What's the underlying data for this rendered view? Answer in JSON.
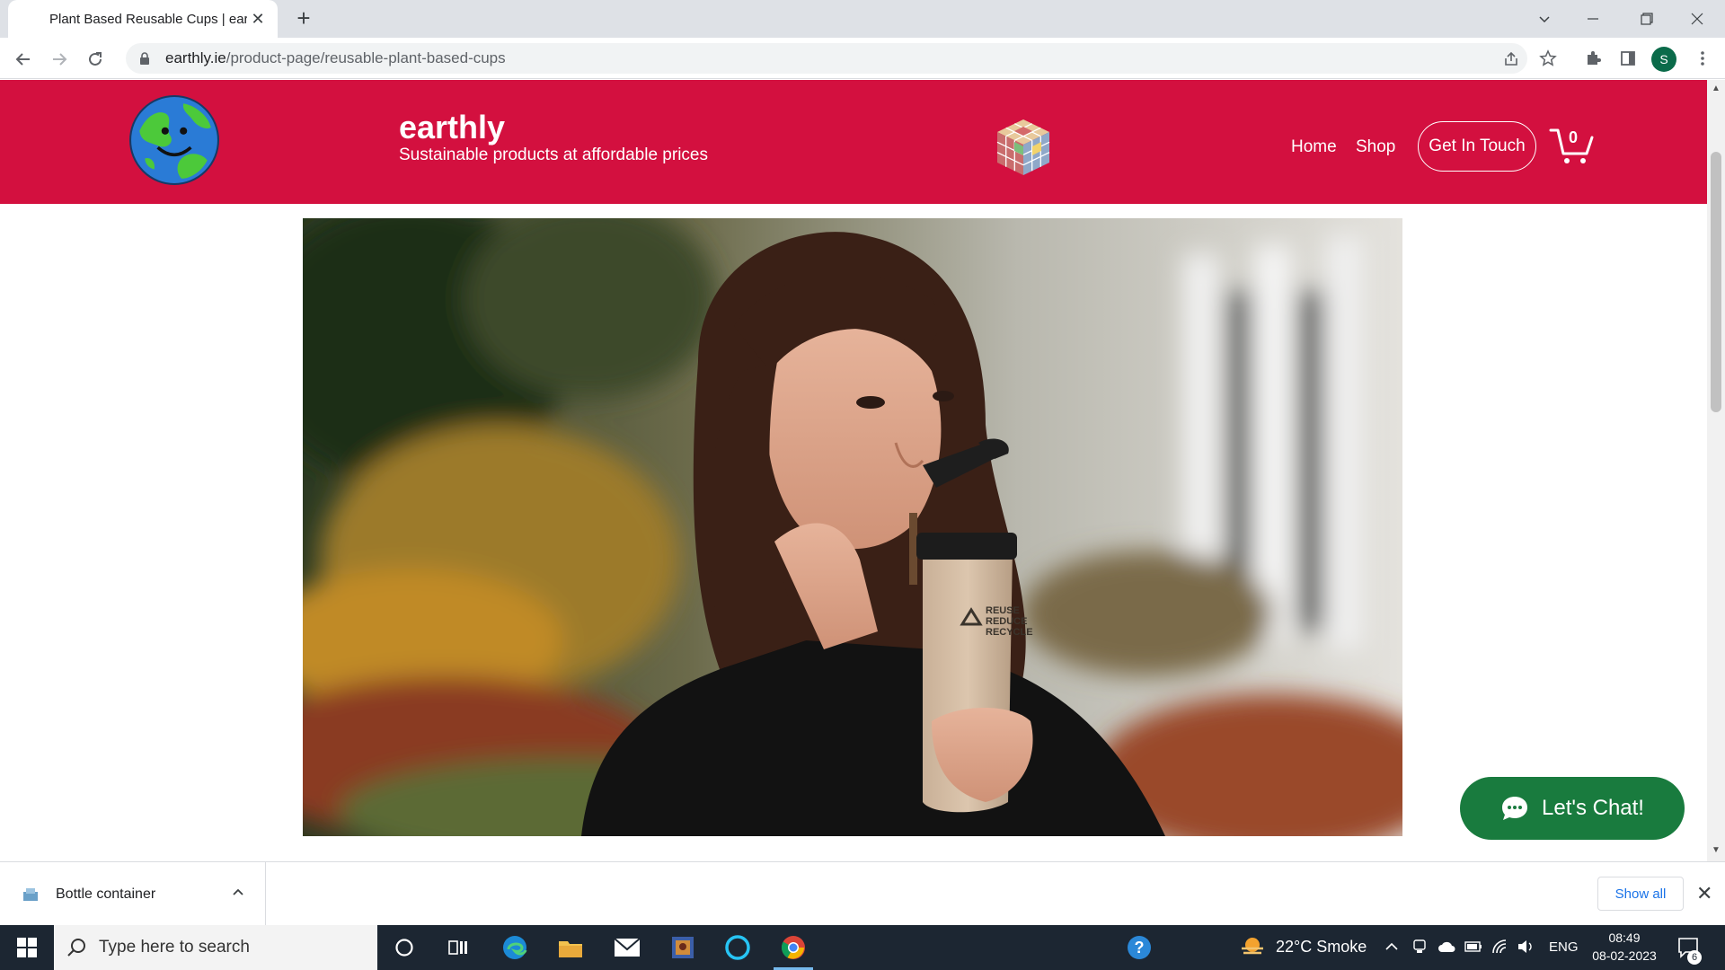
{
  "browser": {
    "tab_title": "Plant Based Reusable Cups | earthly",
    "url_host": "earthly.ie",
    "url_path": "/product-page/reusable-plant-based-cups",
    "profile_initial": "S"
  },
  "site": {
    "brand_name": "earthly",
    "tagline": "Sustainable products at affordable prices",
    "nav": [
      "Home",
      "Shop"
    ],
    "cta_label": "Get In Touch",
    "cart_count": "0",
    "header_color": "#d3103f",
    "cup_print": [
      "REUSE",
      "REDUCE",
      "RECYCLE"
    ]
  },
  "chat": {
    "label": "Let's Chat!",
    "color": "#197b3e"
  },
  "downloads": {
    "file_name": "Bottle container",
    "show_all_label": "Show all"
  },
  "taskbar": {
    "search_placeholder": "Type here to search",
    "weather": "22°C  Smoke",
    "language": "ENG",
    "time": "08:49",
    "date": "08-02-2023",
    "notification_count": "6"
  }
}
